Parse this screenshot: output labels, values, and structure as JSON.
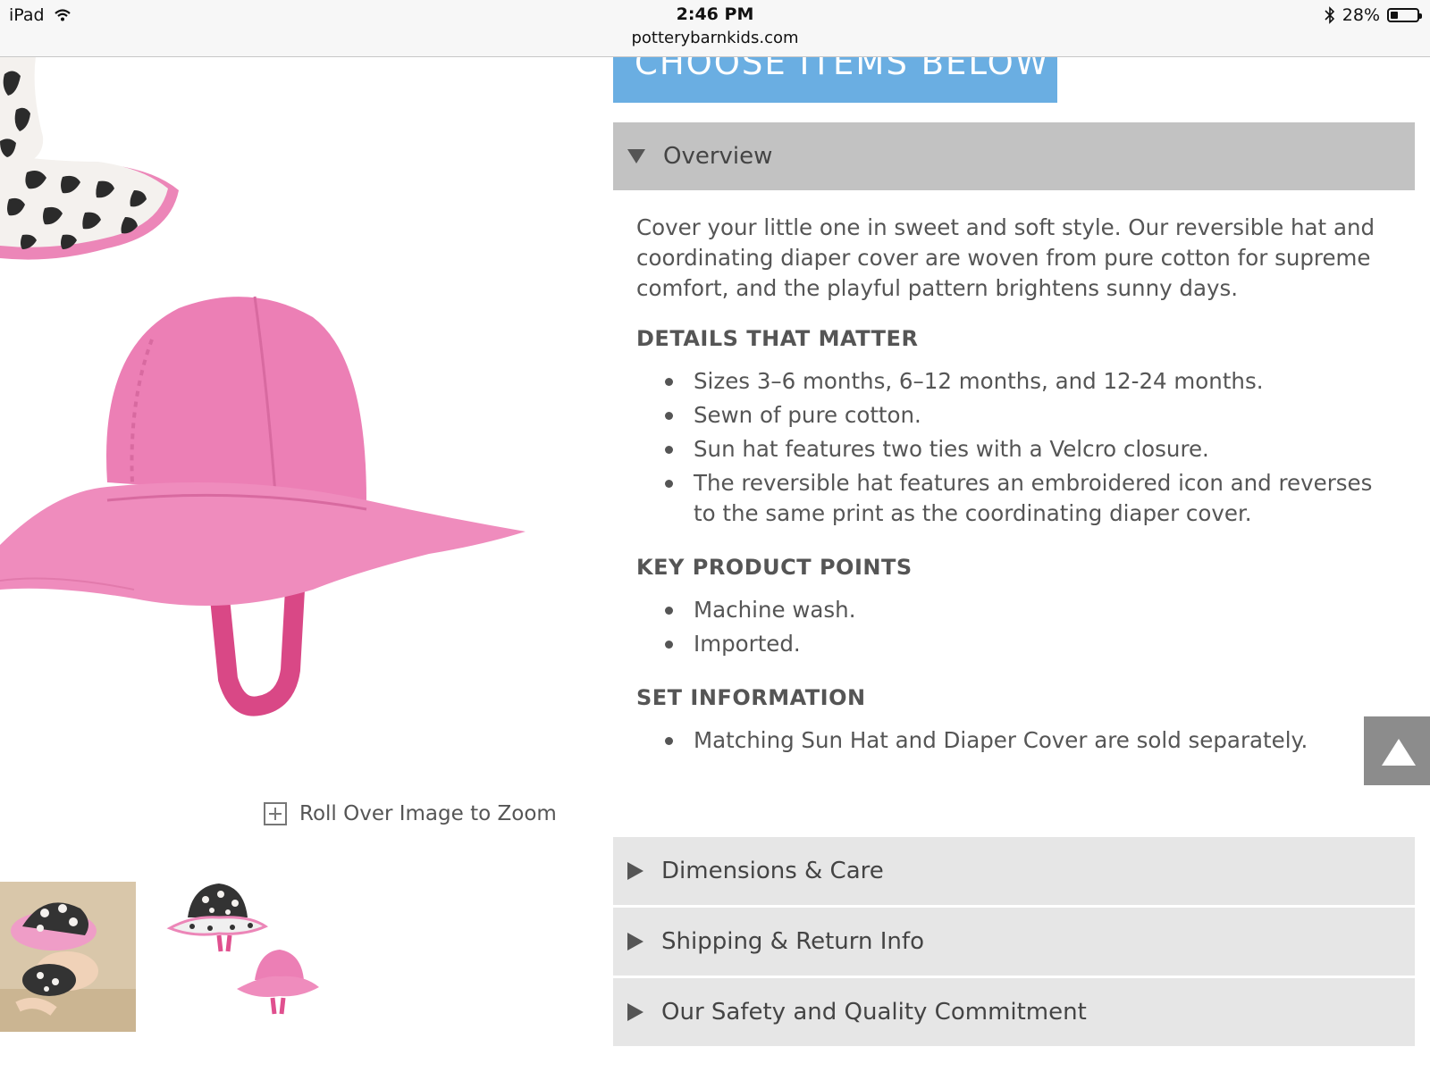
{
  "status_bar": {
    "device": "iPad",
    "time": "2:46 PM",
    "url": "potterybarnkids.com",
    "battery": "28%",
    "battery_level": 0.28
  },
  "product": {
    "zoom_label": "Roll Over Image to Zoom",
    "choose_button": "CHOOSE ITEMS BELOW"
  },
  "overview": {
    "label": "Overview",
    "description": "Cover your little one in sweet and soft style. Our reversible hat and coordinating diaper cover are woven from pure cotton for supreme comfort, and the playful pattern brightens sunny days.",
    "details_heading": "DETAILS THAT MATTER",
    "details": [
      "Sizes 3–6 months, 6–12 months, and 12-24 months.",
      "Sewn of pure cotton.",
      "Sun hat features two ties with a Velcro closure.",
      "The reversible hat features an embroidered icon and reverses to the same print as the coordinating diaper cover."
    ],
    "key_heading": "KEY PRODUCT POINTS",
    "key_points": [
      "Machine wash.",
      "Imported."
    ],
    "set_heading": "SET INFORMATION",
    "set_info": [
      "Matching Sun Hat and Diaper Cover are sold separately."
    ]
  },
  "accordions": [
    {
      "label": "Dimensions & Care"
    },
    {
      "label": "Shipping & Return Info"
    },
    {
      "label": "Our Safety and Quality Commitment"
    }
  ],
  "colors": {
    "accent_blue": "#6aaee2",
    "hat_pink": "#ec7fb5",
    "accordion_open": "#c2c2c2",
    "accordion_closed": "#e6e6e6"
  }
}
